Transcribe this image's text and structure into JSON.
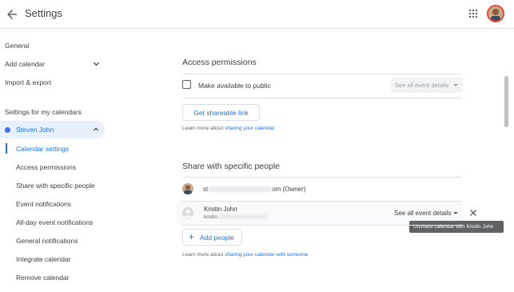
{
  "header": {
    "title": "Settings"
  },
  "sidebar": {
    "general": "General",
    "add_calendar": "Add calendar",
    "import_export": "Import & export",
    "section_title": "Settings for my calendars",
    "calendar_name": "Steven John",
    "sub_items": [
      "Calendar settings",
      "Access permissions",
      "Share with specific people",
      "Event notifications",
      "All-day event notifications",
      "General notifications",
      "Integrate calendar",
      "Remove calendar"
    ]
  },
  "access": {
    "title": "Access permissions",
    "public_label": "Make available to public",
    "public_select": "See all event details",
    "shareable_link_label": "Get shareable link",
    "learn_prefix": "Learn more about ",
    "learn_link": "sharing your calendar"
  },
  "share": {
    "title": "Share with specific people",
    "owner_prefix": "st",
    "owner_suffix": "om (Owner)",
    "person_name": "Kristin John",
    "person_email_prefix": "kristin.",
    "person_permission": "See all event details",
    "tooltip": "Unshare calendar with Kristin John",
    "add_people_label": "Add people",
    "learn_prefix": "Learn more about ",
    "learn_link": "sharing your calendar with someone"
  },
  "colors": {
    "accent": "#1a73e8",
    "calendar_dot": "#3f6fe8",
    "selected_bg": "#e8f0fe"
  }
}
